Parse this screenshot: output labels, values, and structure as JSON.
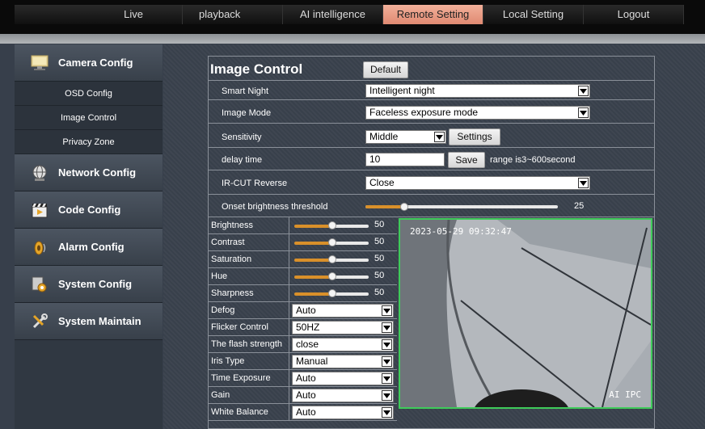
{
  "nav": {
    "tabs": [
      {
        "label": "Live",
        "active": false
      },
      {
        "label": "playback",
        "active": false
      },
      {
        "label": "AI intelligence",
        "active": false
      },
      {
        "label": "Remote Setting",
        "active": true
      },
      {
        "label": "Local Setting",
        "active": false
      },
      {
        "label": "Logout",
        "active": false
      }
    ]
  },
  "sidebar": {
    "camera_config": "Camera Config",
    "sub_items": [
      "OSD Config",
      "Image Control",
      "Privacy Zone"
    ],
    "network_config": "Network Config",
    "code_config": "Code Config",
    "alarm_config": "Alarm Config",
    "system_config": "System Config",
    "system_maintain": "System Maintain"
  },
  "panel": {
    "title": "Image Control",
    "default_label": "Default",
    "smart_night": {
      "label": "Smart Night",
      "value": "Intelligent night"
    },
    "image_mode": {
      "label": "Image Mode",
      "value": "Faceless exposure mode"
    },
    "sensitivity": {
      "label": "Sensitivity",
      "value": "Middle",
      "settings_label": "Settings"
    },
    "delay_time": {
      "label": "delay time",
      "value": "10",
      "save_label": "Save",
      "range_text": "range is3~600second"
    },
    "ircut": {
      "label": "IR-CUT Reverse",
      "value": "Close"
    },
    "onset": {
      "label": "Onset brightness threshold",
      "value": "25",
      "level": 0.2
    }
  },
  "sliders": [
    {
      "label": "Brightness",
      "value": "50"
    },
    {
      "label": "Contrast",
      "value": "50"
    },
    {
      "label": "Saturation",
      "value": "50"
    },
    {
      "label": "Hue",
      "value": "50"
    },
    {
      "label": "Sharpness",
      "value": "50"
    }
  ],
  "selects": [
    {
      "label": "Defog",
      "value": "Auto"
    },
    {
      "label": "Flicker Control",
      "value": "50HZ"
    },
    {
      "label": "The flash strength",
      "value": "close"
    },
    {
      "label": "Iris Type",
      "value": "Manual"
    },
    {
      "label": "Time Exposure",
      "value": "Auto"
    },
    {
      "label": "Gain",
      "value": "Auto"
    },
    {
      "label": "White Balance",
      "value": "Auto"
    }
  ],
  "video": {
    "timestamp": "2023-05-29 09:32:47",
    "watermark": "AI IPC"
  },
  "colors": {
    "active_tab": "#e08a72",
    "slider_fill": "#d9902a",
    "video_border": "#3fcb5a"
  }
}
